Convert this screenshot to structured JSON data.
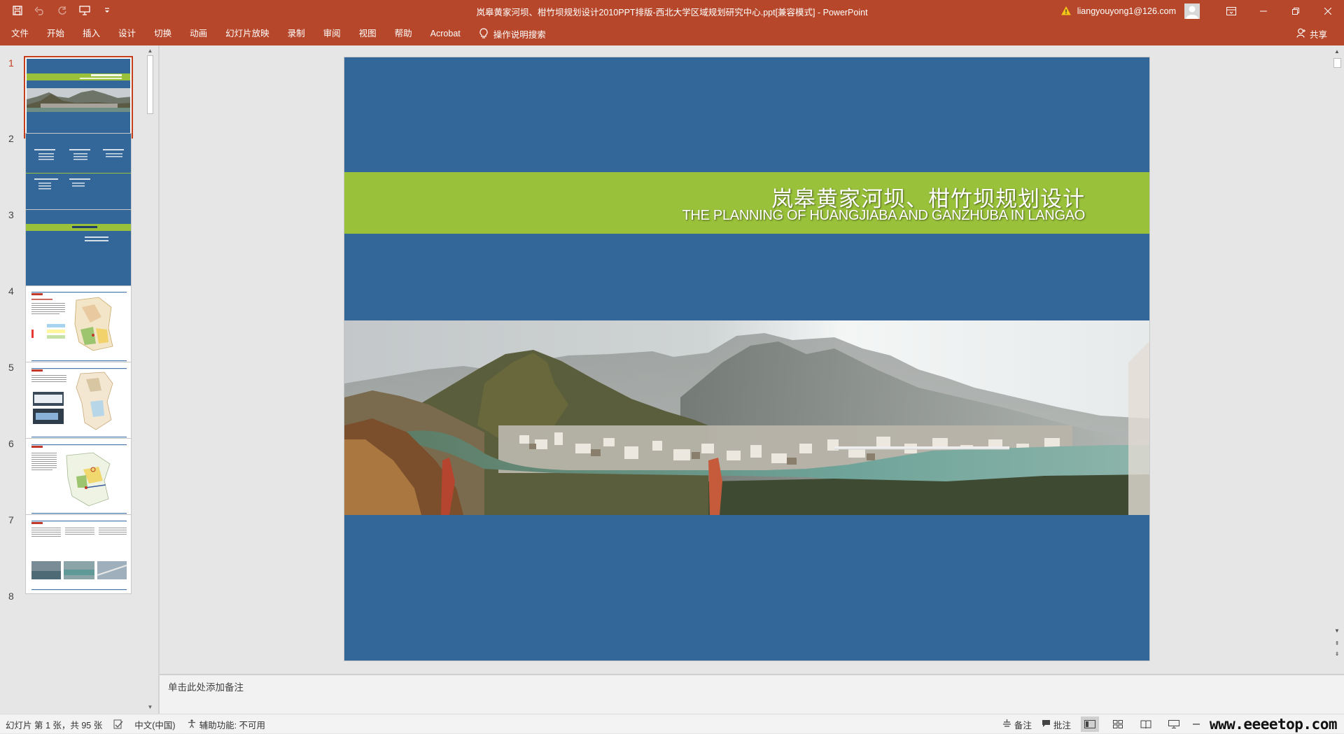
{
  "titlebar": {
    "window_title": "岚皋黄家河坝、柑竹坝规划设计2010PPT排版-西北大学区域规划研究中心.ppt[兼容模式]  -  PowerPoint",
    "user_email": "liangyouyong1@126.com",
    "qat_icons": [
      "save-icon",
      "undo-icon",
      "redo-icon",
      "present-icon",
      "customize-icon"
    ]
  },
  "ribbon": {
    "tabs": [
      "文件",
      "开始",
      "插入",
      "设计",
      "切换",
      "动画",
      "幻灯片放映",
      "录制",
      "审阅",
      "视图",
      "帮助",
      "Acrobat"
    ],
    "tell_me": "操作说明搜索",
    "share": "共享"
  },
  "thumbnails": {
    "numbers": [
      "1",
      "2",
      "3",
      "4",
      "5",
      "6",
      "7",
      "8"
    ],
    "selected": "1"
  },
  "slide": {
    "title_cn": "岚皋黄家河坝、柑竹坝规划设计",
    "title_en": "THE PLANNING OF HUANGJIABA AND GANZHUBA IN LANGAO",
    "background_color": "#336699",
    "band_color": "#99c13a"
  },
  "notes": {
    "placeholder": "单击此处添加备注"
  },
  "statusbar": {
    "slide_info": "幻灯片 第 1 张，共 95 张",
    "language": "中文(中国)",
    "accessibility": "辅助功能: 不可用",
    "notes_label": "备注",
    "comments_label": "批注",
    "watermark": "www.eeeetop.com"
  },
  "colors": {
    "accent": "#b7472a",
    "selection": "#c43e1c"
  }
}
